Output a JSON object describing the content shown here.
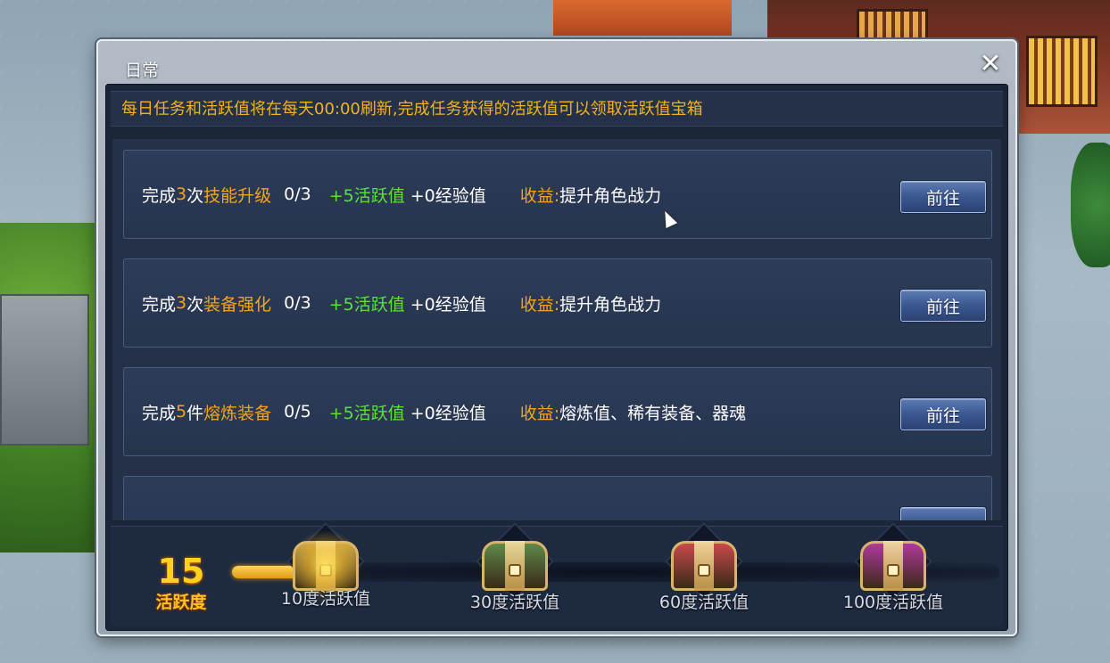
{
  "window": {
    "title": "日常",
    "close_icon": "close-icon"
  },
  "notice": "每日任务和活跃值将在每天00:00刷新,完成任务获得的活跃值可以领取活跃值宝箱",
  "tasks": [
    {
      "prefix": "完成",
      "count": "3",
      "unit": "次",
      "name": "技能升级",
      "progress": "0/3",
      "activity_reward": "+5活跃值",
      "exp_reward": "+0经验值",
      "benefit_label": "收益:",
      "benefit": "提升角色战力",
      "button": "前往"
    },
    {
      "prefix": "完成",
      "count": "3",
      "unit": "次",
      "name": "装备强化",
      "progress": "0/3",
      "activity_reward": "+5活跃值",
      "exp_reward": "+0经验值",
      "benefit_label": "收益:",
      "benefit": "提升角色战力",
      "button": "前往"
    },
    {
      "prefix": "完成",
      "count": "5",
      "unit": "件",
      "name": "熔炼装备",
      "progress": "0/5",
      "activity_reward": "+5活跃值",
      "exp_reward": "+0经验值",
      "benefit_label": "收益:",
      "benefit": "熔炼值、稀有装备、器魂",
      "button": "前往"
    }
  ],
  "activity": {
    "value": "15",
    "label": "活跃度",
    "progress_fraction": 0.15,
    "chests": [
      {
        "label": "10度活跃值",
        "color": "#c9a24a",
        "state": "ready"
      },
      {
        "label": "30度活跃值",
        "color": "#5f8a4a",
        "state": "locked"
      },
      {
        "label": "60度活跃值",
        "color": "#c84a4a",
        "state": "locked"
      },
      {
        "label": "100度活跃值",
        "color": "#b0389a",
        "state": "locked"
      }
    ]
  },
  "colors": {
    "highlight": "#f2a51c",
    "reward_green": "#5ce13a",
    "notice_text": "#f2b31c"
  }
}
